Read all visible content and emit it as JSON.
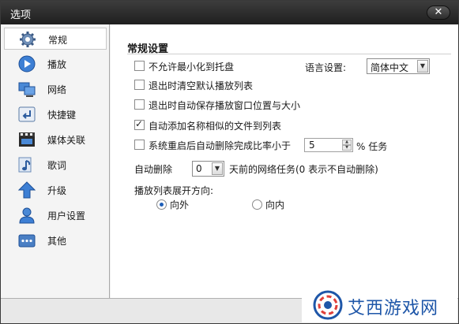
{
  "window": {
    "title": "选项",
    "close_symbol": "✕"
  },
  "sidebar": {
    "items": [
      {
        "label": "常规",
        "icon": "gear-icon",
        "active": true
      },
      {
        "label": "播放",
        "icon": "play-icon",
        "active": false
      },
      {
        "label": "网络",
        "icon": "network-icon",
        "active": false
      },
      {
        "label": "快捷键",
        "icon": "keyboard-icon",
        "active": false
      },
      {
        "label": "媒体关联",
        "icon": "clapperboard-icon",
        "active": false
      },
      {
        "label": "歌词",
        "icon": "music-note-icon",
        "active": false
      },
      {
        "label": "升级",
        "icon": "upgrade-arrow-icon",
        "active": false
      },
      {
        "label": "用户设置",
        "icon": "user-icon",
        "active": false
      },
      {
        "label": "其他",
        "icon": "etc-icon",
        "active": false
      }
    ]
  },
  "general": {
    "section_title": "常规设置",
    "options": [
      {
        "label": "不允许最小化到托盘",
        "checked": false
      },
      {
        "label": "退出时清空默认播放列表",
        "checked": false
      },
      {
        "label": "退出时自动保存播放窗口位置与大小",
        "checked": false
      },
      {
        "label": "自动添加名称相似的文件到列表",
        "checked": true
      },
      {
        "label": "系统重启后自动删除完成比率小于",
        "checked": false
      }
    ],
    "language": {
      "label": "语言设置:",
      "value": "简体中文"
    },
    "ratio": {
      "value": "5",
      "suffix": "% 任务"
    },
    "auto_delete": {
      "label": "自动删除",
      "value": "0",
      "suffix": "天前的网络任务(0 表示不自动删除)"
    },
    "playlist_direction": {
      "label": "播放列表展开方向:",
      "options": [
        {
          "label": "向外",
          "selected": true
        },
        {
          "label": "向内",
          "selected": false
        }
      ]
    }
  },
  "watermark": {
    "text": "艾西游戏网"
  }
}
